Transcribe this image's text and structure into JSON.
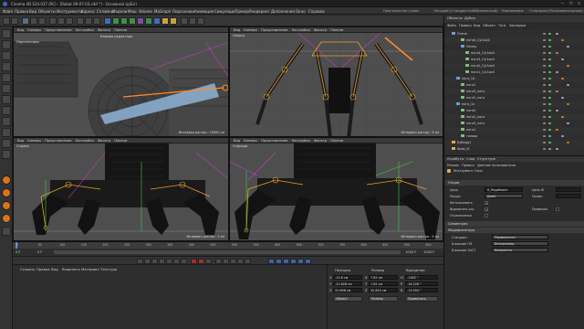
{
  "window": {
    "title": "Cinema 4D S24.037 (RC) - [Robot 09-07-03.c4d *] - Основной (д/Бл)",
    "controls": [
      "—",
      "❐",
      "✕"
    ]
  },
  "menubar": {
    "items": [
      "Файл",
      "Правка",
      "Вид",
      "Объекты",
      "Инструменты",
      "Каркас",
      "Сплайны",
      "Модели",
      "Меш",
      "Volume",
      "MoGraph",
      "Персонажи",
      "Анимация",
      "Симуляция",
      "Трекер",
      "Рендеринг",
      "Дополнения",
      "Окно",
      "Справка"
    ],
    "right": [
      "Пространство узлов:",
      "Текущий (Стандартный/Физический)",
      "Компоновка:",
      "Стартовая (Пользовательская)"
    ]
  },
  "viewports": [
    {
      "id": "tl",
      "label": "Перспектива",
      "camera": "Камера редактора",
      "menu": [
        "Вид",
        "Камеры",
        "Представление",
        "Настройки",
        "Фильтр",
        "Панели"
      ],
      "grid": "Интервал растра : 10000 см"
    },
    {
      "id": "tr",
      "label": "Сверху",
      "camera": "",
      "menu": [
        "Вид",
        "Камеры",
        "Представление",
        "Настройки",
        "Фильтр",
        "Панели"
      ],
      "grid": "Интервал растра : 5 см"
    },
    {
      "id": "bl",
      "label": "Справа",
      "camera": "",
      "menu": [
        "Вид",
        "Камеры",
        "Представление",
        "Настройки",
        "Фильтр",
        "Панели"
      ],
      "grid": "Интервал растра : 5 см"
    },
    {
      "id": "br",
      "label": "Спереди",
      "camera": "",
      "menu": [
        "Вид",
        "Камеры",
        "Представление",
        "Настройки",
        "Фильтр",
        "Панели"
      ],
      "grid": "Интервал растра : 5 см"
    }
  ],
  "timeline": {
    "ticks": [
      "0",
      "50",
      "100",
      "150",
      "200",
      "250",
      "300",
      "350",
      "400",
      "450",
      "500",
      "550",
      "600",
      "650",
      "700",
      "750",
      "800",
      "850",
      "900",
      "950"
    ],
    "current": "0 F",
    "start": "0 F",
    "end": "0 F",
    "frame_end": "1000 F",
    "frame_end2": "1000 F"
  },
  "material": {
    "menu": [
      "Создать",
      "Правка",
      "Вид",
      "Выделить",
      "Материал",
      "Текстура"
    ]
  },
  "coords": {
    "headers": [
      "Позиция",
      "Размер",
      "Вращение"
    ],
    "rows": [
      {
        "axis": "X",
        "pos": "-13.6 см",
        "size_axis": "X",
        "size": "7.82 см",
        "rot_axis": "H",
        "rot": "-1382 °"
      },
      {
        "axis": "Y",
        "pos": "-22.828 см",
        "size_axis": "Y",
        "size": "7.82 см",
        "rot_axis": "P",
        "rot": "-16.228 °"
      },
      {
        "axis": "Z",
        "pos": "22.696 см",
        "size_axis": "Z",
        "size": "32.852 см",
        "rot_axis": "B",
        "rot": "-13.054 °"
      }
    ],
    "mode1": "Объект",
    "mode2": "Размер",
    "apply": "Применить"
  },
  "objects": {
    "tabs": [
      "Объекты",
      "Дубли"
    ],
    "menu": [
      "Файл",
      "Правка",
      "Вид",
      "Объект",
      "Тэги",
      "Закладки"
    ],
    "rows": [
      {
        "name": "Плечо",
        "indent": 1,
        "color": "#6fa0d8"
      },
      {
        "name": "нога4_Cyl1ик0",
        "indent": 3,
        "color": "#7fc07f"
      },
      {
        "name": "Палец",
        "indent": 3,
        "color": "#6fa0d8"
      },
      {
        "name": "нога4_Cyl1ик0",
        "indent": 4,
        "color": "#7fc07f"
      },
      {
        "name": "нога3_Cyl1ик0",
        "indent": 4,
        "color": "#7fc07f"
      },
      {
        "name": "нога2_Cyl1ик0",
        "indent": 4,
        "color": "#7fc07f"
      },
      {
        "name": "нога1_Cyl1ик0",
        "indent": 4,
        "color": "#7fc07f"
      },
      {
        "name": "нога_14",
        "indent": 2,
        "color": "#6fa0d8"
      },
      {
        "name": "нога1",
        "indent": 3,
        "color": "#7fc07f"
      },
      {
        "name": "нога3_нога",
        "indent": 3,
        "color": "#7fc07f"
      },
      {
        "name": "нога2_нога",
        "indent": 3,
        "color": "#7fc07f"
      },
      {
        "name": "нога_1к",
        "indent": 2,
        "color": "#6fa0d8"
      },
      {
        "name": "нога4",
        "indent": 3,
        "color": "#7fc07f"
      },
      {
        "name": "нога2_нога",
        "indent": 3,
        "color": "#7fc07f"
      },
      {
        "name": "нога3_нога",
        "indent": 3,
        "color": "#7fc07f"
      },
      {
        "name": "нога1",
        "indent": 3,
        "color": "#7fc07f"
      },
      {
        "name": "голова",
        "indent": 3,
        "color": "#7fc07f"
      },
      {
        "name": "Кубоид1",
        "indent": 1,
        "color": "#d8b04f"
      },
      {
        "name": "Nook_IK",
        "indent": 1,
        "color": "#d8b04f"
      }
    ]
  },
  "attributes": {
    "tabs": [
      "Атрибуты",
      "Слои",
      "Структура"
    ],
    "menu": [
      "Режим",
      "Правка",
      "Данные пользователя"
    ],
    "object_name": "Инструмент Cirpa",
    "section_main": "Опции",
    "fields": [
      {
        "label": "Цель",
        "value": "6_Подобъект"
      },
      {
        "label": "Ракурс",
        "value": "Дом4"
      },
      {
        "label": "Использовать",
        "value": ""
      },
      {
        "label": "Выровнять ось",
        "value": ""
      },
      {
        "label": "Ограничения",
        "value": ""
      }
    ],
    "right_fields": [
      {
        "label": "Цель IK",
        "value": ""
      },
      {
        "label": "Полюс",
        "value": ""
      },
      {
        "label": "Привязка",
        "value": ""
      }
    ],
    "section2": "Симметрия",
    "section3": "Модификаторы",
    "mods": [
      {
        "label": "Стандарт",
        "value": "Первоисточн."
      },
      {
        "label": "Ближние ГМ",
        "value": "Интерполяц."
      },
      {
        "label": "Ближние ЭлСТ",
        "value": "Конкретно"
      }
    ]
  }
}
